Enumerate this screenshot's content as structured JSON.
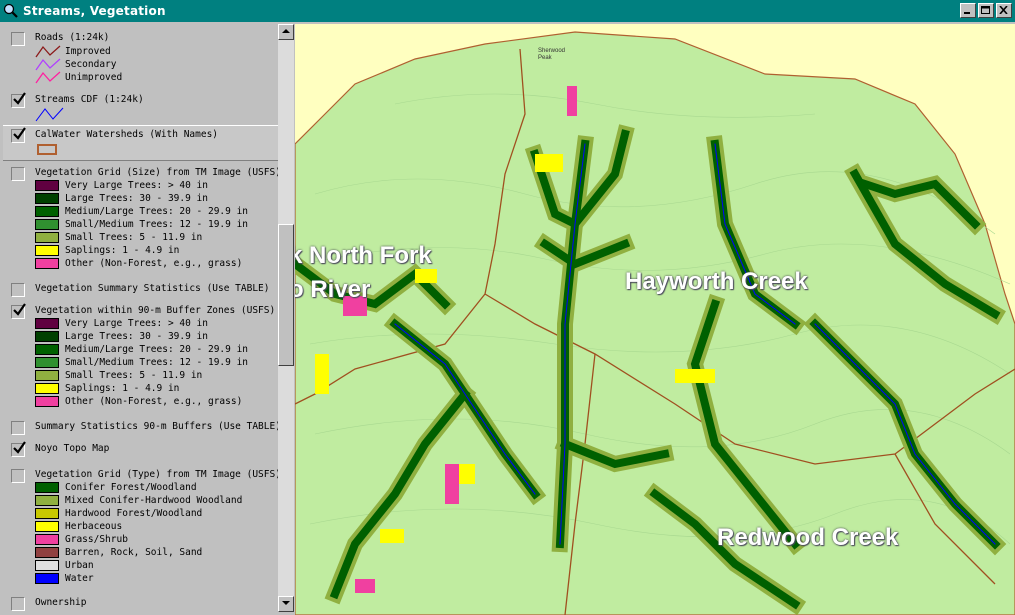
{
  "window": {
    "title": "Streams, Vegetation"
  },
  "legend": {
    "roads": {
      "title": "Roads (1:24k)",
      "items": [
        "Improved",
        "Secondary",
        "Unimproved"
      ],
      "colors": [
        "#8b1a1a",
        "#b040ff",
        "#ff20a0"
      ]
    },
    "streams": {
      "title": "Streams CDF (1:24k)",
      "color": "#0000ff"
    },
    "calwater": {
      "title": "CalWater Watersheds (With Names)",
      "color": "#b06030"
    },
    "veg_size": {
      "title": "Vegetation Grid (Size) from TM Image (USFS)",
      "items": [
        {
          "label": "Very Large Trees: > 40  in",
          "color": "#600040"
        },
        {
          "label": "Large Trees: 30 - 39.9 in",
          "color": "#004000"
        },
        {
          "label": "Medium/Large Trees: 20 - 29.9 in",
          "color": "#006000"
        },
        {
          "label": "Small/Medium Trees: 12 - 19.9 in",
          "color": "#309030"
        },
        {
          "label": "Small Trees: 5 - 11.9 in",
          "color": "#90b040"
        },
        {
          "label": "Saplings: 1 - 4.9 in",
          "color": "#ffff00"
        },
        {
          "label": "Other (Non-Forest, e.g., grass)",
          "color": "#f040a0"
        }
      ]
    },
    "veg_summary": {
      "title": "Vegetation Summary Statistics (Use TABLE)"
    },
    "veg_buffer": {
      "title": "Vegetation within 90-m Buffer Zones (USFS)",
      "items": [
        {
          "label": "Very Large Trees: > 40  in",
          "color": "#600040"
        },
        {
          "label": "Large Trees: 30 - 39.9 in",
          "color": "#004000"
        },
        {
          "label": "Medium/Large Trees: 20 - 29.9 in",
          "color": "#006000"
        },
        {
          "label": "Small/Medium Trees: 12 - 19.9 in",
          "color": "#309030"
        },
        {
          "label": "Small Trees: 5 - 11.9 in",
          "color": "#90b040"
        },
        {
          "label": "Saplings: 1 - 4.9 in",
          "color": "#ffff00"
        },
        {
          "label": "Other (Non-Forest, e.g., grass)",
          "color": "#f040a0"
        }
      ]
    },
    "buffer_summary": {
      "title": "Summary Statistics 90-m Buffers (Use TABLE)"
    },
    "topo": {
      "title": "Noyo Topo Map"
    },
    "veg_type": {
      "title": "Vegetation Grid (Type) from TM Image (USFS)",
      "items": [
        {
          "label": "Conifer Forest/Woodland",
          "color": "#006000"
        },
        {
          "label": "Mixed Conifer-Hardwood Woodland",
          "color": "#90b040"
        },
        {
          "label": "Hardwood Forest/Woodland",
          "color": "#c8c800"
        },
        {
          "label": "Herbaceous",
          "color": "#ffff00"
        },
        {
          "label": "Grass/Shrub",
          "color": "#f040a0"
        },
        {
          "label": "Barren, Rock, Soil, Sand",
          "color": "#904040"
        },
        {
          "label": "Urban",
          "color": "#e0e0e0"
        },
        {
          "label": "Water",
          "color": "#0000ff"
        }
      ]
    },
    "ownership": {
      "title": "Ownership"
    }
  },
  "map": {
    "labels": {
      "north_fork_1": "k North Fork",
      "north_fork_2": "o River",
      "hayworth": "Hayworth Creek",
      "redwood": "Redwood Creek",
      "peak": "Sherwood\nPeak"
    }
  }
}
